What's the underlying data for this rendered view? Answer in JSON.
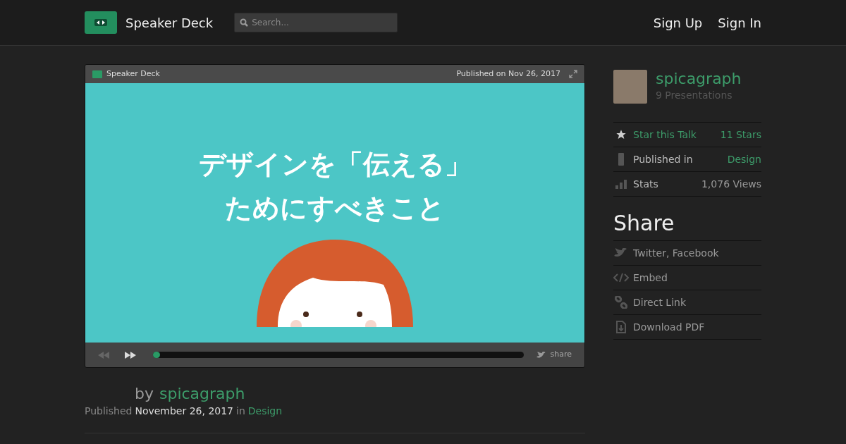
{
  "header": {
    "brand": "Speaker Deck",
    "search": {
      "placeholder": "Search..."
    },
    "nav": [
      "Sign Up",
      "Sign In"
    ]
  },
  "player": {
    "brand": "Speaker Deck",
    "published": "Published on Nov 26, 2017",
    "slide_title": [
      "デザインを「伝える」",
      "ためにすべきこと"
    ],
    "progress": {
      "level": 0.0
    },
    "share": "share"
  },
  "byline": {
    "by": "by",
    "author": "spicagraph",
    "published_label": "Published",
    "date": "November 26, 2017",
    "in_label": "in",
    "category": "Design"
  },
  "author": {
    "name": "spicagraph",
    "presentations": "9 Presentations"
  },
  "meta": [
    {
      "kind": "star",
      "label": "Star this Talk",
      "value": "11 Stars"
    },
    {
      "kind": "published",
      "label": "Published in",
      "value": "Design"
    },
    {
      "kind": "stats",
      "label": "Stats",
      "value": "1,076 Views"
    }
  ],
  "share": {
    "title": "Share",
    "items": [
      {
        "kind": "twitter",
        "label": "Twitter, Facebook"
      },
      {
        "kind": "embed",
        "label": "Embed"
      },
      {
        "kind": "link",
        "label": "Direct Link"
      },
      {
        "kind": "pdf",
        "label": "Download PDF"
      }
    ]
  }
}
